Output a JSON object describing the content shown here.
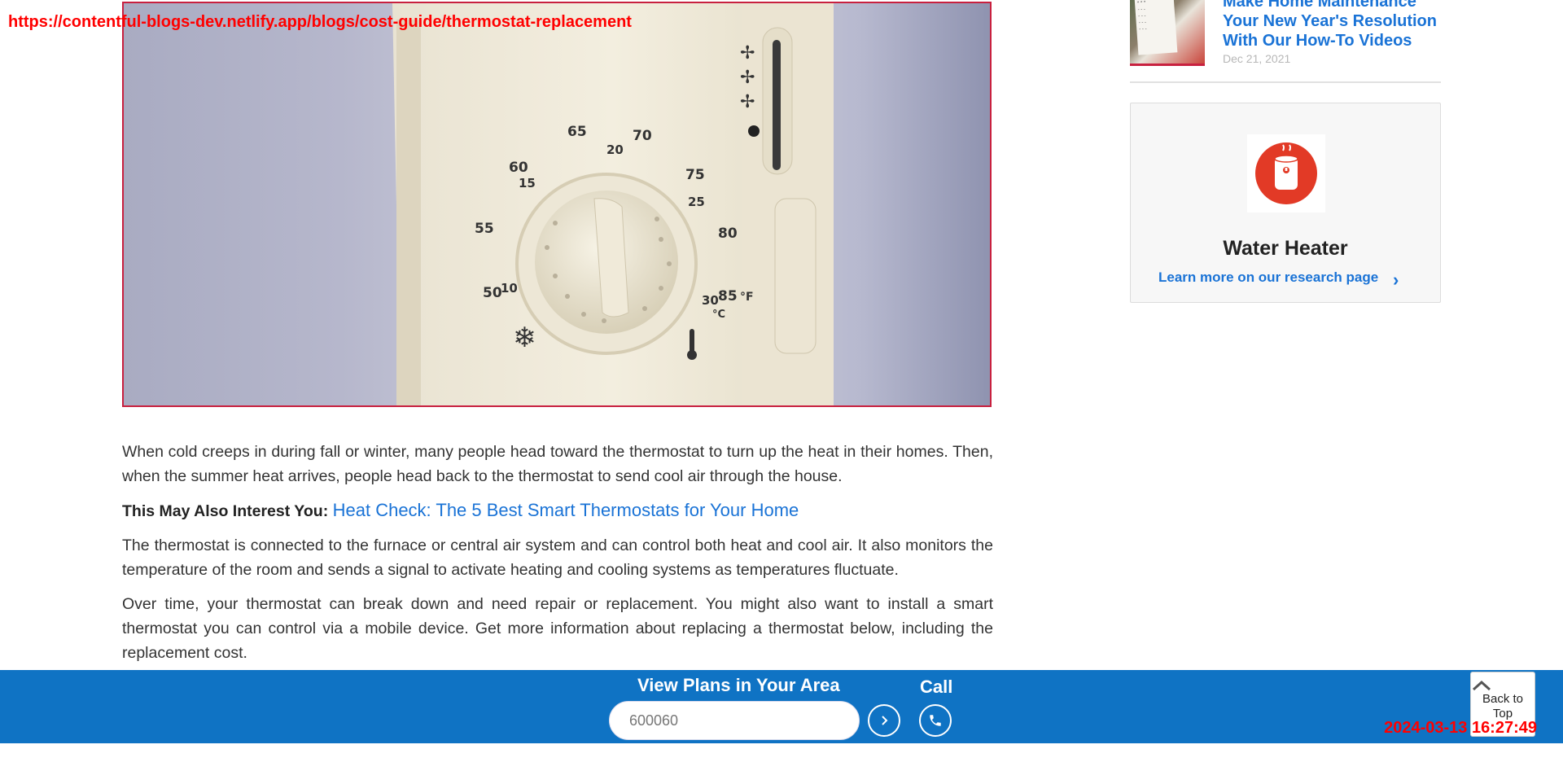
{
  "overlay": {
    "url": "https://contentful-blogs-dev.netlify.app/blogs/cost-guide/thermostat-replacement",
    "timestamp": "2024-03-13 16:27:49"
  },
  "hero": {
    "image_icon": "thermostat-photo",
    "dial_numbers_f": [
      "50",
      "55",
      "60",
      "65",
      "70",
      "75",
      "80",
      "85"
    ],
    "dial_numbers_c": [
      "10",
      "15",
      "20",
      "25",
      "30"
    ],
    "unit_f": "°F",
    "unit_c": "°C"
  },
  "article": {
    "paragraph1": "When cold creeps in during fall or winter, many people head toward the thermostat to turn up the heat in their homes. Then, when the summer heat arrives, people head back to the thermostat to send cool air through the house.",
    "interest_label": "This May Also Interest You:",
    "interest_link": "Heat Check: The 5 Best Smart Thermostats for Your Home",
    "paragraph2": "The thermostat is connected to the furnace or central air system and can control both heat and cool air. It also monitors the temperature of the room and sends a signal to activate heating and cooling systems as temperatures fluctuate.",
    "paragraph3": "Over time, your thermostat can break down and need repair or replacement. You might also want to install a smart thermostat you can control via a mobile device. Get more information about replacing a thermostat below, including the replacement cost."
  },
  "sidebar": {
    "related_title": "Make Home Maintenance Your New Year's Resolution With Our How-To Videos",
    "related_date": "Dec 21, 2021",
    "card_title": "Water Heater",
    "card_link": "Learn more on our research page",
    "card_icon": "water-heater-icon"
  },
  "bottom_bar": {
    "plans_label": "View Plans in Your Area",
    "zip_value": "600060",
    "call_label": "Call",
    "back_to_top_label": "Back to Top"
  },
  "colors": {
    "brand_blue": "#0f73c4",
    "link_blue": "#1a73d6",
    "accent_red": "#e23a26",
    "overlay_red": "#ff0000"
  }
}
